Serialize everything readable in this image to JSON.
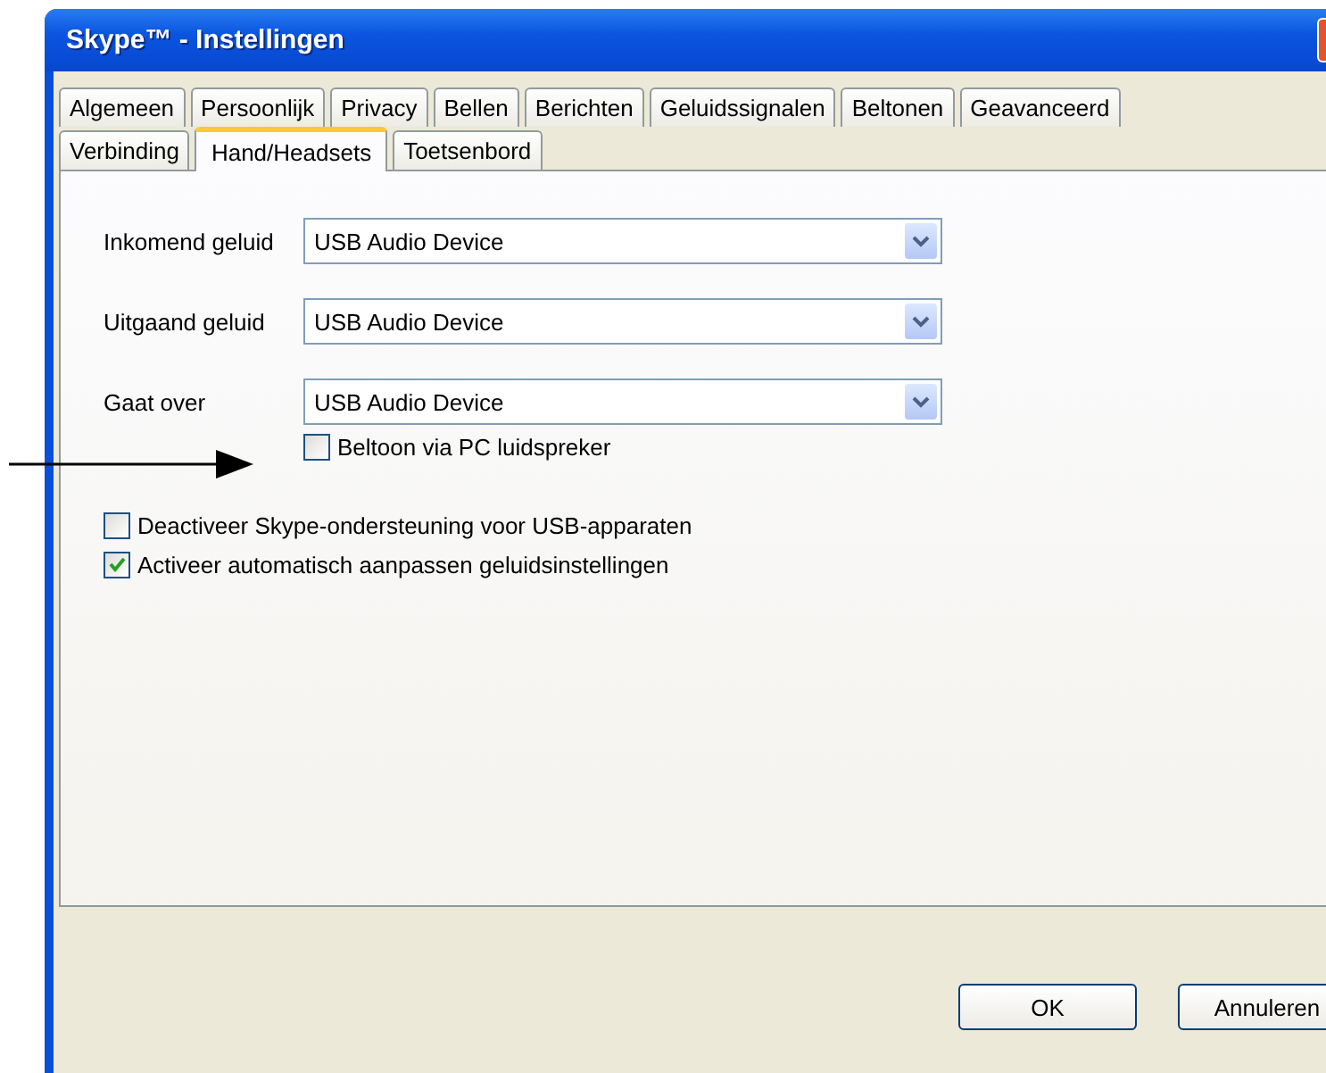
{
  "window": {
    "title": "Skype™ - Instellingen"
  },
  "tab_rows": [
    [
      {
        "label": "Algemeen",
        "selected": false
      },
      {
        "label": "Persoonlijk",
        "selected": false
      },
      {
        "label": "Privacy",
        "selected": false
      },
      {
        "label": "Bellen",
        "selected": false
      },
      {
        "label": "Berichten",
        "selected": false
      },
      {
        "label": "Geluidssignalen",
        "selected": false
      },
      {
        "label": "Beltonen",
        "selected": false
      },
      {
        "label": "Geavanceerd",
        "selected": false
      }
    ],
    [
      {
        "label": "Verbinding",
        "selected": false
      },
      {
        "label": "Hand/Headsets",
        "selected": true
      },
      {
        "label": "Toetsenbord",
        "selected": false
      }
    ]
  ],
  "devices": [
    {
      "label": "Inkomend geluid",
      "value": "USB Audio Device"
    },
    {
      "label": "Uitgaand geluid",
      "value": "USB Audio Device"
    },
    {
      "label": "Gaat over",
      "value": "USB Audio Device"
    }
  ],
  "ring_option": {
    "label": "Beltoon via PC luidspreker",
    "checked": false
  },
  "options": [
    {
      "label": "Deactiveer Skype-ondersteuning voor USB-apparaten",
      "checked": false
    },
    {
      "label": "Activeer automatisch aanpassen geluidsinstellingen",
      "checked": true
    }
  ],
  "buttons": [
    "OK",
    "Annuleren"
  ]
}
